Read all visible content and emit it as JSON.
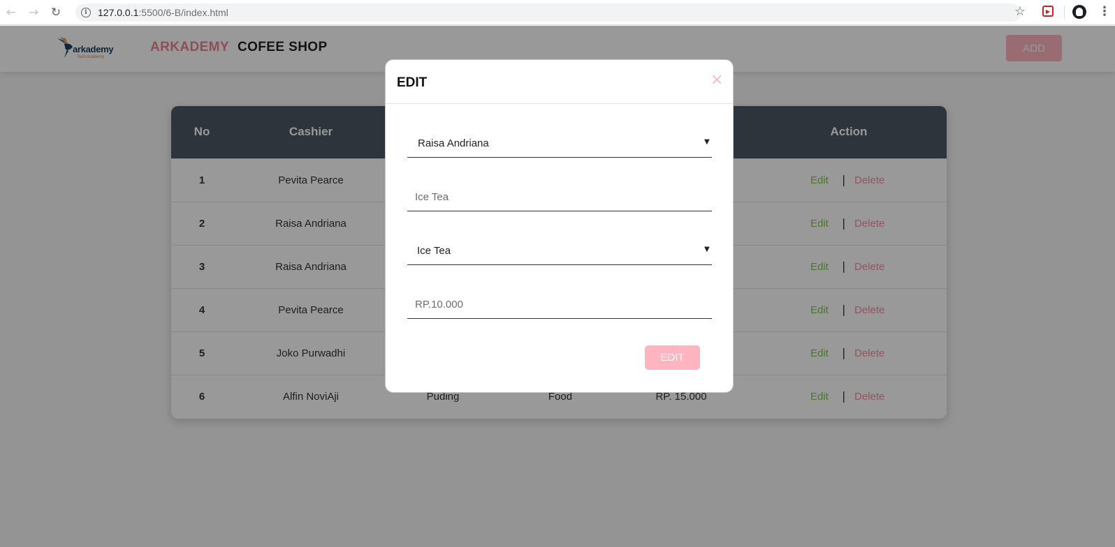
{
  "browser": {
    "url_host": "127.0.0.1",
    "url_path": ":5500/6-B/index.html",
    "back_icon": "←",
    "forward_icon": "→",
    "reload_icon": "↻",
    "info_icon": "i",
    "star_icon": "☆",
    "menu_icon": "⋮"
  },
  "navbar": {
    "logo_text": "arkademy",
    "logo_sub": "Tech Academy",
    "brand_primary": "ARKADEMY",
    "brand_secondary": "COFEE SHOP",
    "add_label": "ADD",
    "colors": {
      "brand_pink": "#e8848f",
      "add_button": "#ffb4c0"
    }
  },
  "table": {
    "headers": {
      "no": "No",
      "cashier": "Cashier",
      "action": "Action"
    },
    "rows": [
      {
        "no": "1",
        "cashier": "Pevita Pearce",
        "edit": "Edit",
        "sep": "|",
        "delete": "Delete"
      },
      {
        "no": "2",
        "cashier": "Raisa Andriana",
        "edit": "Edit",
        "sep": "|",
        "delete": "Delete"
      },
      {
        "no": "3",
        "cashier": "Raisa Andriana",
        "edit": "Edit",
        "sep": "|",
        "delete": "Delete"
      },
      {
        "no": "4",
        "cashier": "Pevita Pearce",
        "edit": "Edit",
        "sep": "|",
        "delete": "Delete"
      },
      {
        "no": "5",
        "cashier": "Joko Purwadhi",
        "edit": "Edit",
        "sep": "|",
        "delete": "Delete"
      },
      {
        "no": "6",
        "cashier": "Alfin NoviAji",
        "product": "Puding",
        "category": "Food",
        "price": "RP. 15.000",
        "edit": "Edit",
        "sep": "|",
        "delete": "Delete"
      }
    ],
    "colors": {
      "header_bg": "#4c5865",
      "edit": "#7ac943",
      "delete": "#f28e9c"
    }
  },
  "modal": {
    "title": "EDIT",
    "close_icon": "×",
    "cashier_select": "Raisa Andriana",
    "product_placeholder": "Ice Tea",
    "category_select": "Ice Tea",
    "price_placeholder": "RP.10.000",
    "caret": "▼",
    "submit_label": "EDIT"
  }
}
